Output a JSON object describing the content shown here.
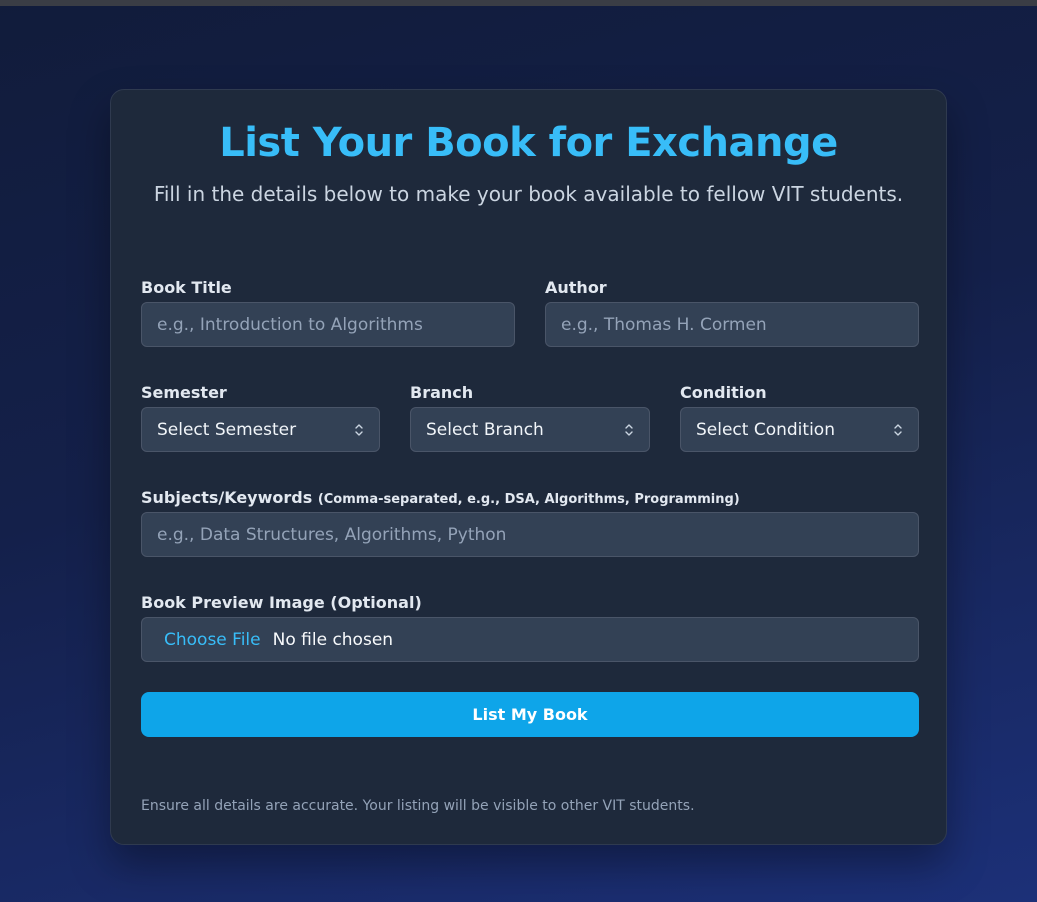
{
  "header": {
    "title": "List Your Book for Exchange",
    "subtitle": "Fill in the details below to make your book available to fellow VIT students."
  },
  "form": {
    "book_title": {
      "label": "Book Title",
      "placeholder": "e.g., Introduction to Algorithms",
      "value": ""
    },
    "author": {
      "label": "Author",
      "placeholder": "e.g., Thomas H. Cormen",
      "value": ""
    },
    "semester": {
      "label": "Semester",
      "selected": "Select Semester"
    },
    "branch": {
      "label": "Branch",
      "selected": "Select Branch"
    },
    "condition": {
      "label": "Condition",
      "selected": "Select Condition"
    },
    "subjects": {
      "label": "Subjects/Keywords",
      "hint": "(Comma-separated, e.g., DSA, Algorithms, Programming)",
      "placeholder": "e.g., Data Structures, Algorithms, Python",
      "value": ""
    },
    "image": {
      "label": "Book Preview Image (Optional)",
      "button_label": "Choose File",
      "status": "No file chosen"
    },
    "submit_label": "List My Book"
  },
  "footnote": "Ensure all details are accurate. Your listing will be visible to other VIT students.",
  "colors": {
    "accent": "#38bdf8",
    "button": "#0ea5e9",
    "card": "#1e293b",
    "input": "#334155"
  },
  "icons": {
    "select_chevron": "chevron-up-down-icon"
  }
}
